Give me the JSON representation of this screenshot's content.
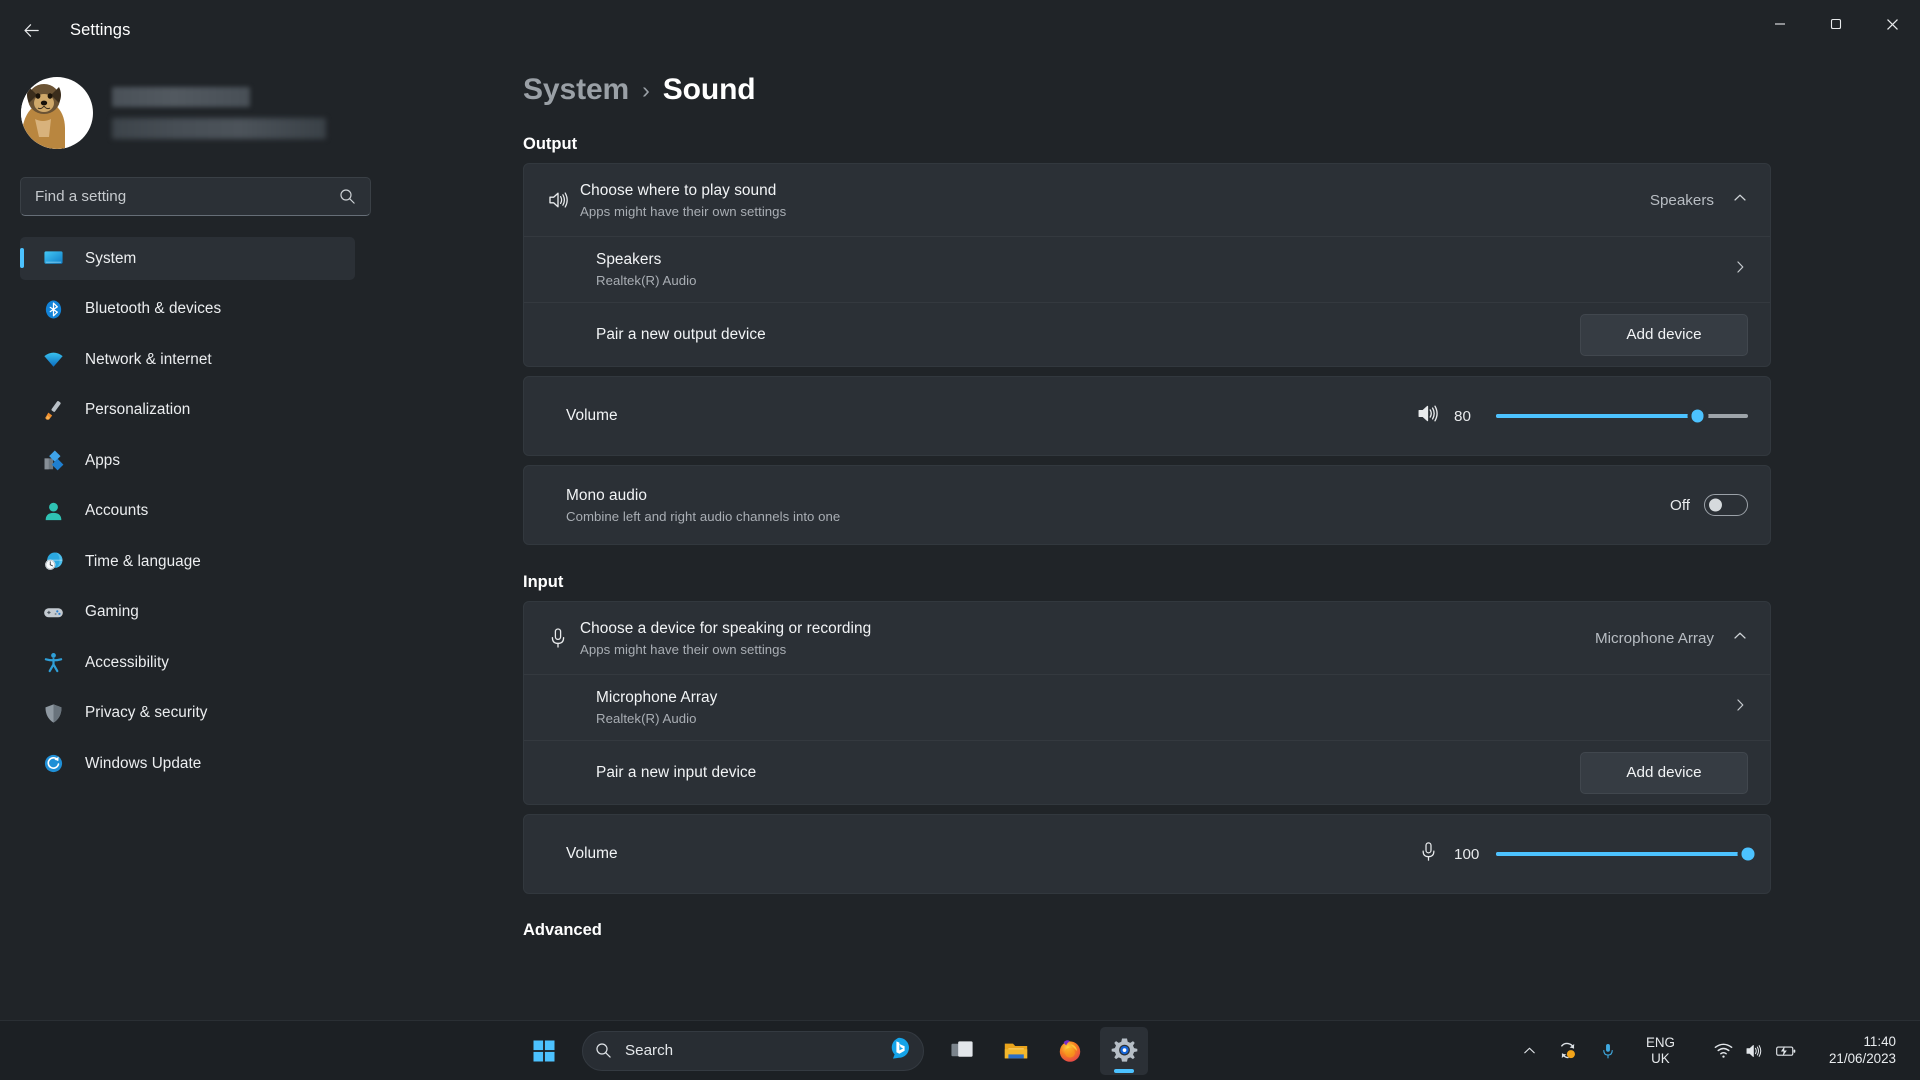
{
  "window": {
    "title": "Settings",
    "back_icon": "back-arrow-icon",
    "minimize_icon": "minimize-icon",
    "maximize_icon": "maximize-icon",
    "close_icon": "close-icon"
  },
  "account": {
    "name_redacted": "",
    "email_redacted": "",
    "avatar_alt": "user-avatar"
  },
  "search": {
    "placeholder": "Find a setting",
    "value": "",
    "icon": "search-icon"
  },
  "sidebar": {
    "items": [
      {
        "label": "System",
        "icon": "system-icon",
        "active": true
      },
      {
        "label": "Bluetooth & devices",
        "icon": "bluetooth-icon",
        "active": false
      },
      {
        "label": "Network & internet",
        "icon": "wifi-icon",
        "active": false
      },
      {
        "label": "Personalization",
        "icon": "paintbrush-icon",
        "active": false
      },
      {
        "label": "Apps",
        "icon": "apps-icon",
        "active": false
      },
      {
        "label": "Accounts",
        "icon": "accounts-icon",
        "active": false
      },
      {
        "label": "Time & language",
        "icon": "clock-globe-icon",
        "active": false
      },
      {
        "label": "Gaming",
        "icon": "gamepad-icon",
        "active": false
      },
      {
        "label": "Accessibility",
        "icon": "accessibility-icon",
        "active": false
      },
      {
        "label": "Privacy & security",
        "icon": "shield-icon",
        "active": false
      },
      {
        "label": "Windows Update",
        "icon": "update-icon",
        "active": false
      }
    ]
  },
  "breadcrumb": {
    "parent": "System",
    "separator": "›",
    "current": "Sound"
  },
  "output": {
    "heading": "Output",
    "chooser": {
      "title": "Choose where to play sound",
      "subtitle": "Apps might have their own settings",
      "value": "Speakers",
      "icon": "speaker-icon",
      "chevron": "chevron-up-icon"
    },
    "device": {
      "name": "Speakers",
      "driver": "Realtek(R) Audio",
      "chevron": "chevron-right-icon"
    },
    "pair": {
      "label": "Pair a new output device",
      "button": "Add device"
    },
    "volume": {
      "label": "Volume",
      "value": 80,
      "min": 0,
      "max": 100,
      "icon": "speaker-icon"
    },
    "mono": {
      "title": "Mono audio",
      "subtitle": "Combine left and right audio channels into one",
      "state": "Off",
      "on": false
    }
  },
  "input": {
    "heading": "Input",
    "chooser": {
      "title": "Choose a device for speaking or recording",
      "subtitle": "Apps might have their own settings",
      "value": "Microphone Array",
      "icon": "microphone-icon",
      "chevron": "chevron-up-icon"
    },
    "device": {
      "name": "Microphone Array",
      "driver": "Realtek(R) Audio",
      "chevron": "chevron-right-icon"
    },
    "pair": {
      "label": "Pair a new input device",
      "button": "Add device"
    },
    "volume": {
      "label": "Volume",
      "value": 100,
      "min": 0,
      "max": 100,
      "icon": "microphone-icon"
    }
  },
  "advanced": {
    "heading": "Advanced"
  },
  "taskbar": {
    "start_icon": "windows-start-icon",
    "search": {
      "placeholder": "Search",
      "icon": "search-icon",
      "copilot_icon": "bing-chat-icon"
    },
    "apps": [
      {
        "name": "task-view",
        "icon": "task-view-icon",
        "active": false
      },
      {
        "name": "file-explorer",
        "icon": "folder-icon",
        "active": false
      },
      {
        "name": "firefox",
        "icon": "firefox-icon",
        "active": false
      },
      {
        "name": "settings",
        "icon": "gear-icon",
        "active": true
      }
    ],
    "tray": {
      "overflow_icon": "chevron-up-icon",
      "onedrive_icon": "onedrive-sync-icon",
      "mic_icon": "microphone-icon",
      "language_top": "ENG",
      "language_bottom": "UK",
      "wifi_icon": "wifi-icon",
      "volume_icon": "speaker-icon",
      "battery_icon": "battery-charging-icon",
      "time": "11:40",
      "date": "21/06/2023"
    }
  },
  "colors": {
    "accent": "#4cc2ff",
    "window_bg": "#202428",
    "card_bg": "#2b3036",
    "taskbar_bg": "#1c2024"
  }
}
